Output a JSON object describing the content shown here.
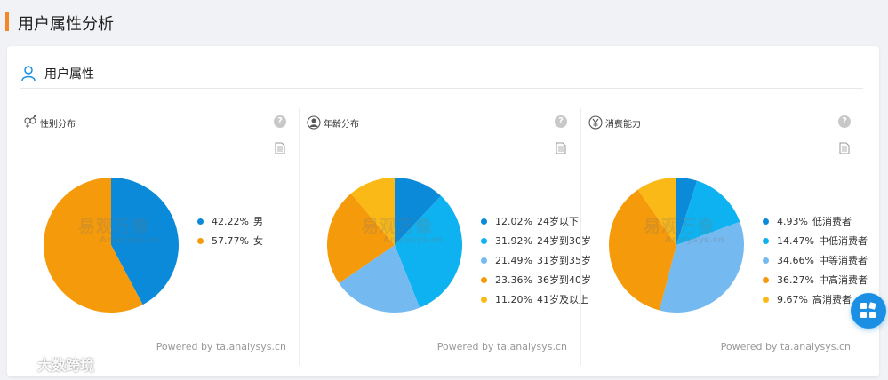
{
  "page": {
    "title": "用户属性分析"
  },
  "section": {
    "title": "用户属性"
  },
  "watermark": {
    "cn": "易观万像",
    "en": "Analysys.cn"
  },
  "brand_watermark": "大数跨境",
  "colors": {
    "accent": "#f5862a",
    "c1": "#0a8ad8",
    "c2": "#0fb2f0",
    "c3": "#74b9f0",
    "c4": "#f59a0b",
    "c5": "#fbb917"
  },
  "panels": [
    {
      "title": "性别分布",
      "icon": "gender-icon",
      "powered": "Powered by ta.analysys.cn",
      "items": [
        {
          "pct": "42.22%",
          "label": "男",
          "value": 42.22,
          "color": "#0a8ad8"
        },
        {
          "pct": "57.77%",
          "label": "女",
          "value": 57.77,
          "color": "#f59a0b"
        }
      ]
    },
    {
      "title": "年龄分布",
      "icon": "person-icon",
      "powered": "Powered by ta.analysys.cn",
      "items": [
        {
          "pct": "12.02%",
          "label": "24岁以下",
          "value": 12.02,
          "color": "#0a8ad8"
        },
        {
          "pct": "31.92%",
          "label": "24岁到30岁",
          "value": 31.92,
          "color": "#0fb2f0"
        },
        {
          "pct": "21.49%",
          "label": "31岁到35岁",
          "value": 21.49,
          "color": "#74b9f0"
        },
        {
          "pct": "23.36%",
          "label": "36岁到40岁",
          "value": 23.36,
          "color": "#f59a0b"
        },
        {
          "pct": "11.20%",
          "label": "41岁及以上",
          "value": 11.2,
          "color": "#fbb917"
        }
      ]
    },
    {
      "title": "消费能力",
      "icon": "yen-icon",
      "powered": "Powered by ta.analysys.cn",
      "items": [
        {
          "pct": "4.93%",
          "label": "低消费者",
          "value": 4.93,
          "color": "#0a8ad8"
        },
        {
          "pct": "14.47%",
          "label": "中低消费者",
          "value": 14.47,
          "color": "#0fb2f0"
        },
        {
          "pct": "34.66%",
          "label": "中等消费者",
          "value": 34.66,
          "color": "#74b9f0"
        },
        {
          "pct": "36.27%",
          "label": "中高消费者",
          "value": 36.27,
          "color": "#f59a0b"
        },
        {
          "pct": "9.67%",
          "label": "高消费者",
          "value": 9.67,
          "color": "#fbb917"
        }
      ]
    }
  ],
  "chart_data": [
    {
      "type": "pie",
      "title": "性别分布",
      "categories": [
        "男",
        "女"
      ],
      "values": [
        42.22,
        57.77
      ]
    },
    {
      "type": "pie",
      "title": "年龄分布",
      "categories": [
        "24岁以下",
        "24岁到30岁",
        "31岁到35岁",
        "36岁到40岁",
        "41岁及以上"
      ],
      "values": [
        12.02,
        31.92,
        21.49,
        23.36,
        11.2
      ]
    },
    {
      "type": "pie",
      "title": "消费能力",
      "categories": [
        "低消费者",
        "中低消费者",
        "中等消费者",
        "中高消费者",
        "高消费者"
      ],
      "values": [
        4.93,
        14.47,
        34.66,
        36.27,
        9.67
      ]
    }
  ]
}
